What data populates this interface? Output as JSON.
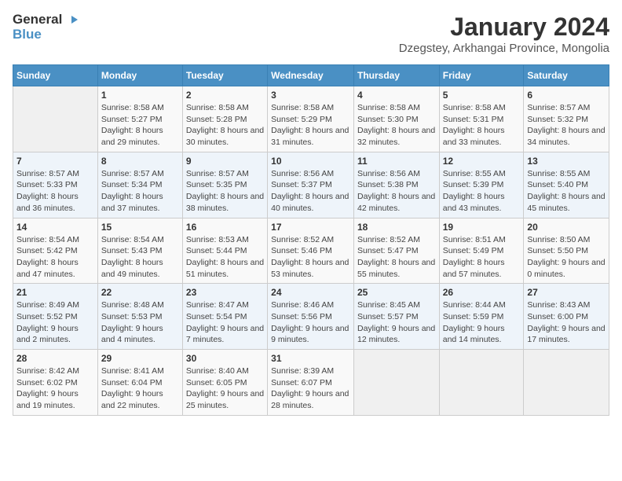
{
  "header": {
    "logo_line1": "General",
    "logo_line2": "Blue",
    "month_title": "January 2024",
    "subtitle": "Dzegstey, Arkhangai Province, Mongolia"
  },
  "days_of_week": [
    "Sunday",
    "Monday",
    "Tuesday",
    "Wednesday",
    "Thursday",
    "Friday",
    "Saturday"
  ],
  "weeks": [
    [
      {
        "day": "",
        "sunrise": "",
        "sunset": "",
        "daylight": ""
      },
      {
        "day": "1",
        "sunrise": "Sunrise: 8:58 AM",
        "sunset": "Sunset: 5:27 PM",
        "daylight": "Daylight: 8 hours and 29 minutes."
      },
      {
        "day": "2",
        "sunrise": "Sunrise: 8:58 AM",
        "sunset": "Sunset: 5:28 PM",
        "daylight": "Daylight: 8 hours and 30 minutes."
      },
      {
        "day": "3",
        "sunrise": "Sunrise: 8:58 AM",
        "sunset": "Sunset: 5:29 PM",
        "daylight": "Daylight: 8 hours and 31 minutes."
      },
      {
        "day": "4",
        "sunrise": "Sunrise: 8:58 AM",
        "sunset": "Sunset: 5:30 PM",
        "daylight": "Daylight: 8 hours and 32 minutes."
      },
      {
        "day": "5",
        "sunrise": "Sunrise: 8:58 AM",
        "sunset": "Sunset: 5:31 PM",
        "daylight": "Daylight: 8 hours and 33 minutes."
      },
      {
        "day": "6",
        "sunrise": "Sunrise: 8:57 AM",
        "sunset": "Sunset: 5:32 PM",
        "daylight": "Daylight: 8 hours and 34 minutes."
      }
    ],
    [
      {
        "day": "7",
        "sunrise": "Sunrise: 8:57 AM",
        "sunset": "Sunset: 5:33 PM",
        "daylight": "Daylight: 8 hours and 36 minutes."
      },
      {
        "day": "8",
        "sunrise": "Sunrise: 8:57 AM",
        "sunset": "Sunset: 5:34 PM",
        "daylight": "Daylight: 8 hours and 37 minutes."
      },
      {
        "day": "9",
        "sunrise": "Sunrise: 8:57 AM",
        "sunset": "Sunset: 5:35 PM",
        "daylight": "Daylight: 8 hours and 38 minutes."
      },
      {
        "day": "10",
        "sunrise": "Sunrise: 8:56 AM",
        "sunset": "Sunset: 5:37 PM",
        "daylight": "Daylight: 8 hours and 40 minutes."
      },
      {
        "day": "11",
        "sunrise": "Sunrise: 8:56 AM",
        "sunset": "Sunset: 5:38 PM",
        "daylight": "Daylight: 8 hours and 42 minutes."
      },
      {
        "day": "12",
        "sunrise": "Sunrise: 8:55 AM",
        "sunset": "Sunset: 5:39 PM",
        "daylight": "Daylight: 8 hours and 43 minutes."
      },
      {
        "day": "13",
        "sunrise": "Sunrise: 8:55 AM",
        "sunset": "Sunset: 5:40 PM",
        "daylight": "Daylight: 8 hours and 45 minutes."
      }
    ],
    [
      {
        "day": "14",
        "sunrise": "Sunrise: 8:54 AM",
        "sunset": "Sunset: 5:42 PM",
        "daylight": "Daylight: 8 hours and 47 minutes."
      },
      {
        "day": "15",
        "sunrise": "Sunrise: 8:54 AM",
        "sunset": "Sunset: 5:43 PM",
        "daylight": "Daylight: 8 hours and 49 minutes."
      },
      {
        "day": "16",
        "sunrise": "Sunrise: 8:53 AM",
        "sunset": "Sunset: 5:44 PM",
        "daylight": "Daylight: 8 hours and 51 minutes."
      },
      {
        "day": "17",
        "sunrise": "Sunrise: 8:52 AM",
        "sunset": "Sunset: 5:46 PM",
        "daylight": "Daylight: 8 hours and 53 minutes."
      },
      {
        "day": "18",
        "sunrise": "Sunrise: 8:52 AM",
        "sunset": "Sunset: 5:47 PM",
        "daylight": "Daylight: 8 hours and 55 minutes."
      },
      {
        "day": "19",
        "sunrise": "Sunrise: 8:51 AM",
        "sunset": "Sunset: 5:49 PM",
        "daylight": "Daylight: 8 hours and 57 minutes."
      },
      {
        "day": "20",
        "sunrise": "Sunrise: 8:50 AM",
        "sunset": "Sunset: 5:50 PM",
        "daylight": "Daylight: 9 hours and 0 minutes."
      }
    ],
    [
      {
        "day": "21",
        "sunrise": "Sunrise: 8:49 AM",
        "sunset": "Sunset: 5:52 PM",
        "daylight": "Daylight: 9 hours and 2 minutes."
      },
      {
        "day": "22",
        "sunrise": "Sunrise: 8:48 AM",
        "sunset": "Sunset: 5:53 PM",
        "daylight": "Daylight: 9 hours and 4 minutes."
      },
      {
        "day": "23",
        "sunrise": "Sunrise: 8:47 AM",
        "sunset": "Sunset: 5:54 PM",
        "daylight": "Daylight: 9 hours and 7 minutes."
      },
      {
        "day": "24",
        "sunrise": "Sunrise: 8:46 AM",
        "sunset": "Sunset: 5:56 PM",
        "daylight": "Daylight: 9 hours and 9 minutes."
      },
      {
        "day": "25",
        "sunrise": "Sunrise: 8:45 AM",
        "sunset": "Sunset: 5:57 PM",
        "daylight": "Daylight: 9 hours and 12 minutes."
      },
      {
        "day": "26",
        "sunrise": "Sunrise: 8:44 AM",
        "sunset": "Sunset: 5:59 PM",
        "daylight": "Daylight: 9 hours and 14 minutes."
      },
      {
        "day": "27",
        "sunrise": "Sunrise: 8:43 AM",
        "sunset": "Sunset: 6:00 PM",
        "daylight": "Daylight: 9 hours and 17 minutes."
      }
    ],
    [
      {
        "day": "28",
        "sunrise": "Sunrise: 8:42 AM",
        "sunset": "Sunset: 6:02 PM",
        "daylight": "Daylight: 9 hours and 19 minutes."
      },
      {
        "day": "29",
        "sunrise": "Sunrise: 8:41 AM",
        "sunset": "Sunset: 6:04 PM",
        "daylight": "Daylight: 9 hours and 22 minutes."
      },
      {
        "day": "30",
        "sunrise": "Sunrise: 8:40 AM",
        "sunset": "Sunset: 6:05 PM",
        "daylight": "Daylight: 9 hours and 25 minutes."
      },
      {
        "day": "31",
        "sunrise": "Sunrise: 8:39 AM",
        "sunset": "Sunset: 6:07 PM",
        "daylight": "Daylight: 9 hours and 28 minutes."
      },
      {
        "day": "",
        "sunrise": "",
        "sunset": "",
        "daylight": ""
      },
      {
        "day": "",
        "sunrise": "",
        "sunset": "",
        "daylight": ""
      },
      {
        "day": "",
        "sunrise": "",
        "sunset": "",
        "daylight": ""
      }
    ]
  ]
}
